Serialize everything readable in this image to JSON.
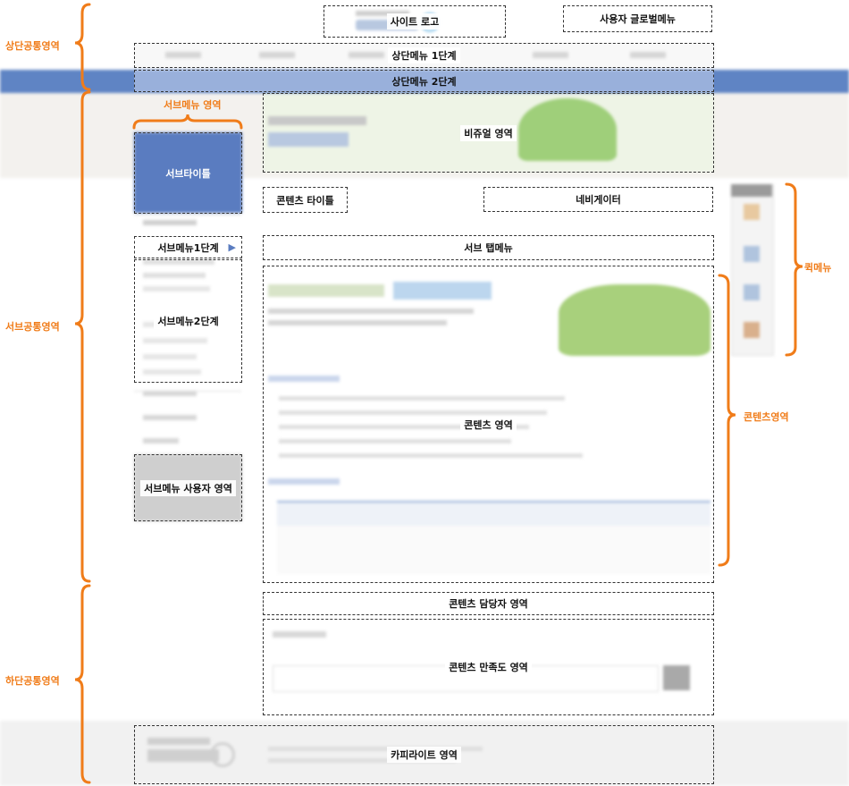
{
  "labels": {
    "header_area": "상단공통영역",
    "site_logo": "사이트 로고",
    "global_menu": "사용자 글로벌메뉴",
    "menu1": "상단메뉴 1단계",
    "menu2": "상단메뉴 2단계",
    "submenu_area": "서브메뉴 영역",
    "sub_title": "서브타이틀",
    "sub_common": "서브공통영역",
    "submenu1": "서브메뉴1단계",
    "submenu2": "서브메뉴2단계",
    "submenu_user": "서브메뉴 사용자 영역",
    "visual": "비쥬얼 영역",
    "content_title": "콘텐츠 타이틀",
    "navigator": "네비게이터",
    "sub_tab": "서브 탭메뉴",
    "content": "콘텐츠 영역",
    "content_area_side": "콘텐츠영역",
    "quick_menu": "퀵메뉴",
    "content_manager": "콘텐츠 담당자 영역",
    "satisfaction": "콘텐츠 만족도 영역",
    "footer_area": "하단공통영역",
    "copyright": "카피라이트 영역"
  },
  "colors": {
    "accent": "#f07c19",
    "nav_bar": "#5f84c4",
    "sub_title_bg": "#5a7cc0"
  }
}
